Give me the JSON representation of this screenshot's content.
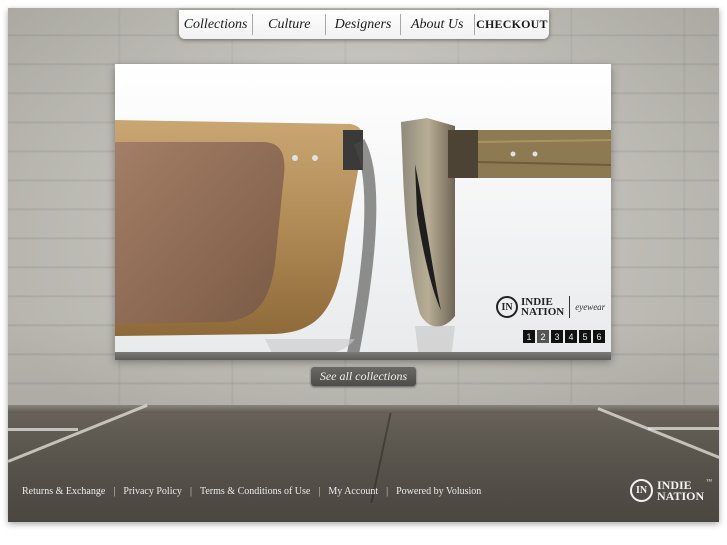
{
  "nav": {
    "items": [
      {
        "label": "Collections"
      },
      {
        "label": "Culture"
      },
      {
        "label": "Designers"
      },
      {
        "label": "About Us"
      },
      {
        "label": "CHECKOUT"
      }
    ]
  },
  "slideshow": {
    "brand": {
      "mark": "IN",
      "line1": "INDIE",
      "line2": "NATION",
      "tagline": "eyewear"
    },
    "pages": [
      "1",
      "2",
      "3",
      "4",
      "5",
      "6"
    ],
    "active_page": "2"
  },
  "see_all": {
    "label": "See all collections"
  },
  "footer": {
    "links": [
      {
        "label": "Returns & Exchange"
      },
      {
        "label": "Privacy Policy"
      },
      {
        "label": "Terms & Conditions of Use"
      },
      {
        "label": "My Account"
      },
      {
        "label": "Powered by Volusion"
      }
    ],
    "logo": {
      "mark": "IN",
      "line1": "INDIE",
      "line2": "NATION",
      "tm": "™"
    }
  },
  "colors": {
    "nav_bg": "#ffffff",
    "button_bg": "#5a5956",
    "footer_text": "#ececec",
    "wood": "#b08a55"
  }
}
